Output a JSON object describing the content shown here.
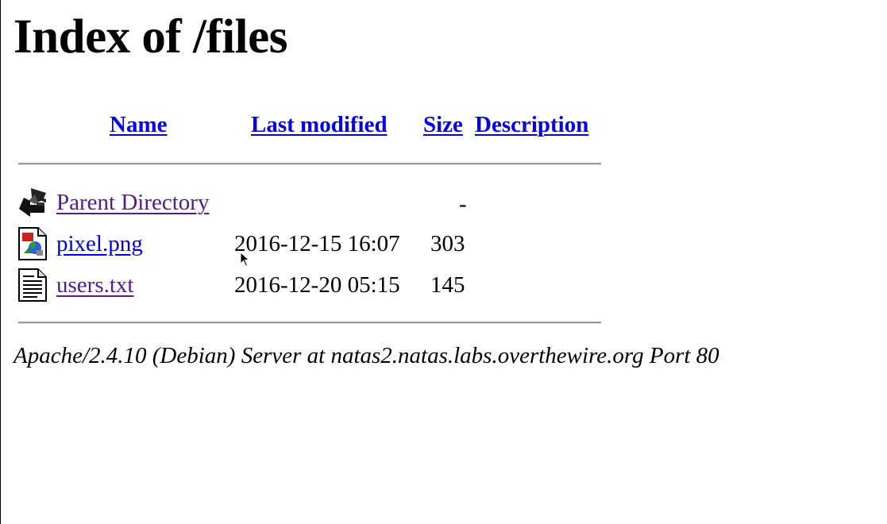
{
  "page": {
    "title": "Index of /files"
  },
  "table": {
    "headers": {
      "name": "Name",
      "last_modified": "Last modified",
      "size": "Size",
      "description": "Description"
    },
    "rows": [
      {
        "icon": "back-arrow-icon",
        "name": "Parent Directory",
        "last_modified": "",
        "size": "-",
        "description": "",
        "visited": true
      },
      {
        "icon": "image-file-icon",
        "name": "pixel.png",
        "last_modified": "2016-12-15 16:07",
        "size": "303",
        "description": "",
        "visited": false
      },
      {
        "icon": "text-file-icon",
        "name": "users.txt",
        "last_modified": "2016-12-20 05:15",
        "size": "145",
        "description": "",
        "visited": true
      }
    ]
  },
  "footer": {
    "address": "Apache/2.4.10 (Debian) Server at natas2.natas.labs.overthewire.org Port 80"
  },
  "colors": {
    "link": "#0000EE",
    "visited_link": "#551A8B",
    "rule": "#9a9a9a"
  }
}
